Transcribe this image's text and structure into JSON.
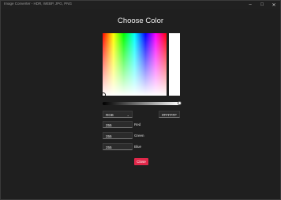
{
  "window": {
    "title": "Image Converter - HDR, WEBP, JPG, PNG",
    "controls": {
      "minimize": "–",
      "maximize": "□",
      "close": "✕"
    }
  },
  "dialog": {
    "title": "Choose Color",
    "mode_select": {
      "value": "RGB",
      "chevron": "⌄"
    },
    "hex": "#FFFFFF",
    "channels": [
      {
        "value": "255",
        "label": "Red"
      },
      {
        "value": "255",
        "label": "Green"
      },
      {
        "value": "255",
        "label": "Blue"
      }
    ],
    "close_label": "Close"
  },
  "colors": {
    "accent": "#e0284a",
    "selected": "#ffffff",
    "background": "#1f1f1f"
  }
}
